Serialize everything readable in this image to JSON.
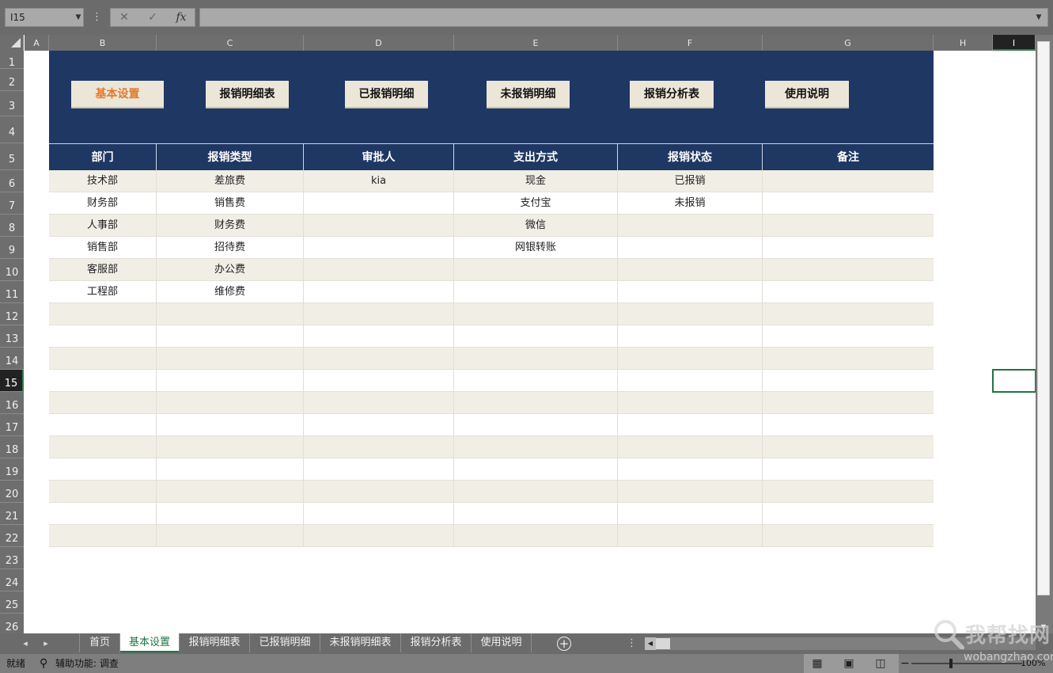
{
  "formula_bar": {
    "name_box": "I15",
    "cancel_icon": "✕",
    "enter_icon": "✓",
    "fx_label": "fx",
    "formula_value": ""
  },
  "columns": [
    "A",
    "B",
    "C",
    "D",
    "E",
    "F",
    "G",
    "H",
    "I"
  ],
  "selected_column": "I",
  "rows": [
    "1",
    "2",
    "3",
    "4",
    "5",
    "6",
    "7",
    "8",
    "9",
    "10",
    "11",
    "12",
    "13",
    "14",
    "15",
    "16",
    "17",
    "18",
    "19",
    "20",
    "21",
    "22",
    "23",
    "24",
    "25",
    "26"
  ],
  "selected_row": "15",
  "nav_buttons": [
    {
      "label": "基本设置",
      "active": true
    },
    {
      "label": "报销明细表",
      "active": false
    },
    {
      "label": "已报销明细",
      "active": false
    },
    {
      "label": "未报销明细",
      "active": false
    },
    {
      "label": "报销分析表",
      "active": false
    },
    {
      "label": "使用说明",
      "active": false
    }
  ],
  "table": {
    "headers": [
      "部门",
      "报销类型",
      "审批人",
      "支出方式",
      "报销状态",
      "备注"
    ],
    "rows": [
      [
        "技术部",
        "差旅费",
        "kia",
        "现金",
        "已报销",
        ""
      ],
      [
        "财务部",
        "销售费",
        "",
        "支付宝",
        "未报销",
        ""
      ],
      [
        "人事部",
        "财务费",
        "",
        "微信",
        "",
        ""
      ],
      [
        "销售部",
        "招待费",
        "",
        "网银转账",
        "",
        ""
      ],
      [
        "客服部",
        "办公费",
        "",
        "",
        "",
        ""
      ],
      [
        "工程部",
        "维修费",
        "",
        "",
        "",
        ""
      ],
      [
        "",
        "",
        "",
        "",
        "",
        ""
      ],
      [
        "",
        "",
        "",
        "",
        "",
        ""
      ],
      [
        "",
        "",
        "",
        "",
        "",
        ""
      ],
      [
        "",
        "",
        "",
        "",
        "",
        ""
      ],
      [
        "",
        "",
        "",
        "",
        "",
        ""
      ],
      [
        "",
        "",
        "",
        "",
        "",
        ""
      ],
      [
        "",
        "",
        "",
        "",
        "",
        ""
      ],
      [
        "",
        "",
        "",
        "",
        "",
        ""
      ],
      [
        "",
        "",
        "",
        "",
        "",
        ""
      ],
      [
        "",
        "",
        "",
        "",
        "",
        ""
      ],
      [
        "",
        "",
        "",
        "",
        "",
        ""
      ]
    ]
  },
  "sheet_tabs": [
    {
      "label": "首页",
      "active": false
    },
    {
      "label": "基本设置",
      "active": true
    },
    {
      "label": "报销明细表",
      "active": false
    },
    {
      "label": "已报销明细",
      "active": false
    },
    {
      "label": "未报销明细表",
      "active": false
    },
    {
      "label": "报销分析表",
      "active": false
    },
    {
      "label": "使用说明",
      "active": false
    }
  ],
  "status_bar": {
    "ready": "就绪",
    "accessibility": "辅助功能: 调查",
    "zoom": "100%"
  },
  "watermark": {
    "cn": "我帮找网",
    "en": "wobangzhao.com"
  },
  "colors": {
    "header_navy": "#1f3763",
    "button_beige": "#ece6d8",
    "active_orange": "#e07b2c",
    "alt_row": "#f0eee5",
    "excel_green": "#217346"
  }
}
